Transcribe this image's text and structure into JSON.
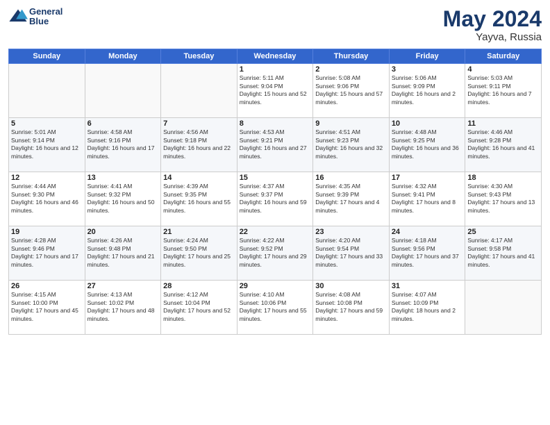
{
  "header": {
    "logo_line1": "General",
    "logo_line2": "Blue",
    "title": "May 2024",
    "location": "Yayva, Russia"
  },
  "weekdays": [
    "Sunday",
    "Monday",
    "Tuesday",
    "Wednesday",
    "Thursday",
    "Friday",
    "Saturday"
  ],
  "weeks": [
    [
      {
        "day": "",
        "sunrise": "",
        "sunset": "",
        "daylight": ""
      },
      {
        "day": "",
        "sunrise": "",
        "sunset": "",
        "daylight": ""
      },
      {
        "day": "",
        "sunrise": "",
        "sunset": "",
        "daylight": ""
      },
      {
        "day": "1",
        "sunrise": "Sunrise: 5:11 AM",
        "sunset": "Sunset: 9:04 PM",
        "daylight": "Daylight: 15 hours and 52 minutes."
      },
      {
        "day": "2",
        "sunrise": "Sunrise: 5:08 AM",
        "sunset": "Sunset: 9:06 PM",
        "daylight": "Daylight: 15 hours and 57 minutes."
      },
      {
        "day": "3",
        "sunrise": "Sunrise: 5:06 AM",
        "sunset": "Sunset: 9:09 PM",
        "daylight": "Daylight: 16 hours and 2 minutes."
      },
      {
        "day": "4",
        "sunrise": "Sunrise: 5:03 AM",
        "sunset": "Sunset: 9:11 PM",
        "daylight": "Daylight: 16 hours and 7 minutes."
      }
    ],
    [
      {
        "day": "5",
        "sunrise": "Sunrise: 5:01 AM",
        "sunset": "Sunset: 9:14 PM",
        "daylight": "Daylight: 16 hours and 12 minutes."
      },
      {
        "day": "6",
        "sunrise": "Sunrise: 4:58 AM",
        "sunset": "Sunset: 9:16 PM",
        "daylight": "Daylight: 16 hours and 17 minutes."
      },
      {
        "day": "7",
        "sunrise": "Sunrise: 4:56 AM",
        "sunset": "Sunset: 9:18 PM",
        "daylight": "Daylight: 16 hours and 22 minutes."
      },
      {
        "day": "8",
        "sunrise": "Sunrise: 4:53 AM",
        "sunset": "Sunset: 9:21 PM",
        "daylight": "Daylight: 16 hours and 27 minutes."
      },
      {
        "day": "9",
        "sunrise": "Sunrise: 4:51 AM",
        "sunset": "Sunset: 9:23 PM",
        "daylight": "Daylight: 16 hours and 32 minutes."
      },
      {
        "day": "10",
        "sunrise": "Sunrise: 4:48 AM",
        "sunset": "Sunset: 9:25 PM",
        "daylight": "Daylight: 16 hours and 36 minutes."
      },
      {
        "day": "11",
        "sunrise": "Sunrise: 4:46 AM",
        "sunset": "Sunset: 9:28 PM",
        "daylight": "Daylight: 16 hours and 41 minutes."
      }
    ],
    [
      {
        "day": "12",
        "sunrise": "Sunrise: 4:44 AM",
        "sunset": "Sunset: 9:30 PM",
        "daylight": "Daylight: 16 hours and 46 minutes."
      },
      {
        "day": "13",
        "sunrise": "Sunrise: 4:41 AM",
        "sunset": "Sunset: 9:32 PM",
        "daylight": "Daylight: 16 hours and 50 minutes."
      },
      {
        "day": "14",
        "sunrise": "Sunrise: 4:39 AM",
        "sunset": "Sunset: 9:35 PM",
        "daylight": "Daylight: 16 hours and 55 minutes."
      },
      {
        "day": "15",
        "sunrise": "Sunrise: 4:37 AM",
        "sunset": "Sunset: 9:37 PM",
        "daylight": "Daylight: 16 hours and 59 minutes."
      },
      {
        "day": "16",
        "sunrise": "Sunrise: 4:35 AM",
        "sunset": "Sunset: 9:39 PM",
        "daylight": "Daylight: 17 hours and 4 minutes."
      },
      {
        "day": "17",
        "sunrise": "Sunrise: 4:32 AM",
        "sunset": "Sunset: 9:41 PM",
        "daylight": "Daylight: 17 hours and 8 minutes."
      },
      {
        "day": "18",
        "sunrise": "Sunrise: 4:30 AM",
        "sunset": "Sunset: 9:43 PM",
        "daylight": "Daylight: 17 hours and 13 minutes."
      }
    ],
    [
      {
        "day": "19",
        "sunrise": "Sunrise: 4:28 AM",
        "sunset": "Sunset: 9:46 PM",
        "daylight": "Daylight: 17 hours and 17 minutes."
      },
      {
        "day": "20",
        "sunrise": "Sunrise: 4:26 AM",
        "sunset": "Sunset: 9:48 PM",
        "daylight": "Daylight: 17 hours and 21 minutes."
      },
      {
        "day": "21",
        "sunrise": "Sunrise: 4:24 AM",
        "sunset": "Sunset: 9:50 PM",
        "daylight": "Daylight: 17 hours and 25 minutes."
      },
      {
        "day": "22",
        "sunrise": "Sunrise: 4:22 AM",
        "sunset": "Sunset: 9:52 PM",
        "daylight": "Daylight: 17 hours and 29 minutes."
      },
      {
        "day": "23",
        "sunrise": "Sunrise: 4:20 AM",
        "sunset": "Sunset: 9:54 PM",
        "daylight": "Daylight: 17 hours and 33 minutes."
      },
      {
        "day": "24",
        "sunrise": "Sunrise: 4:18 AM",
        "sunset": "Sunset: 9:56 PM",
        "daylight": "Daylight: 17 hours and 37 minutes."
      },
      {
        "day": "25",
        "sunrise": "Sunrise: 4:17 AM",
        "sunset": "Sunset: 9:58 PM",
        "daylight": "Daylight: 17 hours and 41 minutes."
      }
    ],
    [
      {
        "day": "26",
        "sunrise": "Sunrise: 4:15 AM",
        "sunset": "Sunset: 10:00 PM",
        "daylight": "Daylight: 17 hours and 45 minutes."
      },
      {
        "day": "27",
        "sunrise": "Sunrise: 4:13 AM",
        "sunset": "Sunset: 10:02 PM",
        "daylight": "Daylight: 17 hours and 48 minutes."
      },
      {
        "day": "28",
        "sunrise": "Sunrise: 4:12 AM",
        "sunset": "Sunset: 10:04 PM",
        "daylight": "Daylight: 17 hours and 52 minutes."
      },
      {
        "day": "29",
        "sunrise": "Sunrise: 4:10 AM",
        "sunset": "Sunset: 10:06 PM",
        "daylight": "Daylight: 17 hours and 55 minutes."
      },
      {
        "day": "30",
        "sunrise": "Sunrise: 4:08 AM",
        "sunset": "Sunset: 10:08 PM",
        "daylight": "Daylight: 17 hours and 59 minutes."
      },
      {
        "day": "31",
        "sunrise": "Sunrise: 4:07 AM",
        "sunset": "Sunset: 10:09 PM",
        "daylight": "Daylight: 18 hours and 2 minutes."
      },
      {
        "day": "",
        "sunrise": "",
        "sunset": "",
        "daylight": ""
      }
    ]
  ]
}
